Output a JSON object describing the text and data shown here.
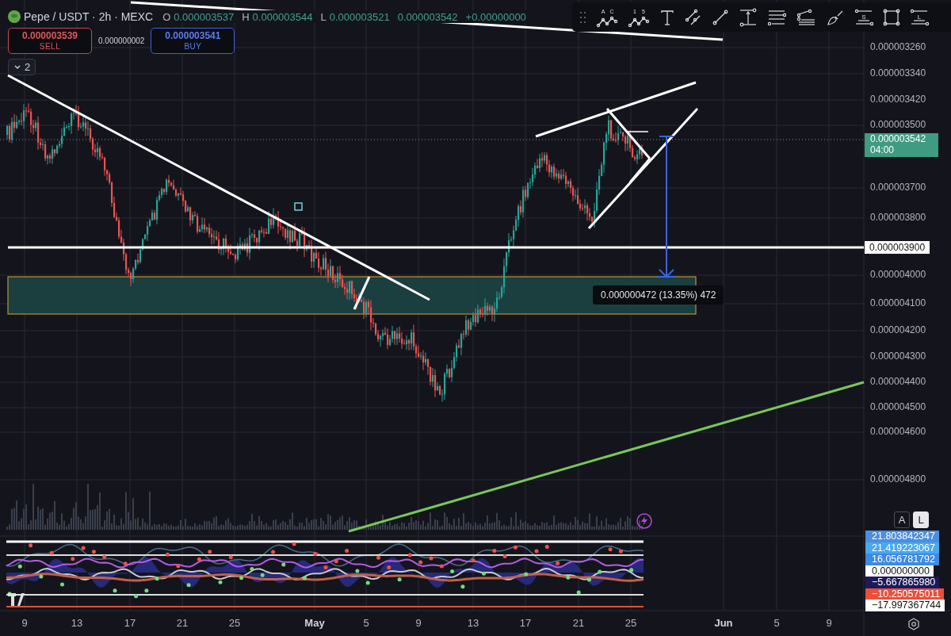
{
  "header": {
    "symbol": "Pepe / USDT · 2h · MEXC",
    "ohlc": [
      {
        "label": "O",
        "value": "0.000003537"
      },
      {
        "label": "H",
        "value": "0.000003544"
      },
      {
        "label": "L",
        "value": "0.000003521"
      },
      {
        "value": "0.000003542"
      }
    ],
    "change": "+0.00000000"
  },
  "trade": {
    "sell": {
      "price": "0.000003539",
      "label": "SELL"
    },
    "spread": "0.000000002",
    "buy": {
      "price": "0.000003541",
      "label": "BUY"
    }
  },
  "indicators_toggle": {
    "count": "2",
    "expanded": false
  },
  "toolbar": [
    {
      "kind": "handle"
    },
    {
      "kind": "pattern",
      "letters": [
        "A",
        "C"
      ]
    },
    {
      "kind": "pattern",
      "letters": [
        "1",
        "5"
      ]
    },
    {
      "kind": "text"
    },
    {
      "kind": "channel"
    },
    {
      "kind": "line"
    },
    {
      "kind": "measure"
    },
    {
      "kind": "hlines"
    },
    {
      "kind": "fib"
    },
    {
      "kind": "brush"
    },
    {
      "kind": "lines",
      "letter": "S"
    },
    {
      "kind": "rectangle"
    },
    {
      "kind": "lines",
      "letter": "L"
    }
  ],
  "price_axis": {
    "ticks": [
      "0.000003260",
      "0.000003340",
      "0.000003420",
      "0.000003500",
      "0.000003700",
      "0.000003800",
      "0.000004000",
      "0.000004100",
      "0.000004200",
      "0.000004300",
      "0.000004400",
      "0.000004500",
      "0.000004600",
      "0.000004800"
    ],
    "last_price": {
      "value": "0.000003542",
      "countdown": "04:00"
    },
    "line_label": "0.000003900"
  },
  "measure": {
    "label": "0.000000472 (13.35%) 472"
  },
  "scale_buttons": [
    {
      "label": "A",
      "selected": false
    },
    {
      "label": "L",
      "selected": true
    }
  ],
  "indicator_axis": [
    {
      "value": "21.803842347",
      "color": "#4a8fe0"
    },
    {
      "value": "21.419223067",
      "color": "#4aa8ec"
    },
    {
      "value": "16.056781792",
      "color": "#3d8ae6"
    },
    {
      "value": "0.000000000",
      "color": "#ffffff"
    },
    {
      "value": "−5.667865980",
      "color": "#1d1a5c"
    },
    {
      "value": "−10.250575011",
      "color": "#ea4f3b"
    },
    {
      "value": "−17.997367744",
      "color": "#ffffff"
    }
  ],
  "time_axis": [
    {
      "label": "9",
      "bold": false
    },
    {
      "label": "13",
      "bold": false
    },
    {
      "label": "17",
      "bold": false
    },
    {
      "label": "21",
      "bold": false
    },
    {
      "label": "25",
      "bold": false
    },
    {
      "label": "May",
      "bold": true
    },
    {
      "label": "5",
      "bold": false
    },
    {
      "label": "9",
      "bold": false
    },
    {
      "label": "13",
      "bold": false
    },
    {
      "label": "17",
      "bold": false
    },
    {
      "label": "21",
      "bold": false
    },
    {
      "label": "25",
      "bold": false
    },
    {
      "label": "Jun",
      "bold": true
    },
    {
      "label": "5",
      "bold": false
    },
    {
      "label": "9",
      "bold": false
    }
  ]
}
